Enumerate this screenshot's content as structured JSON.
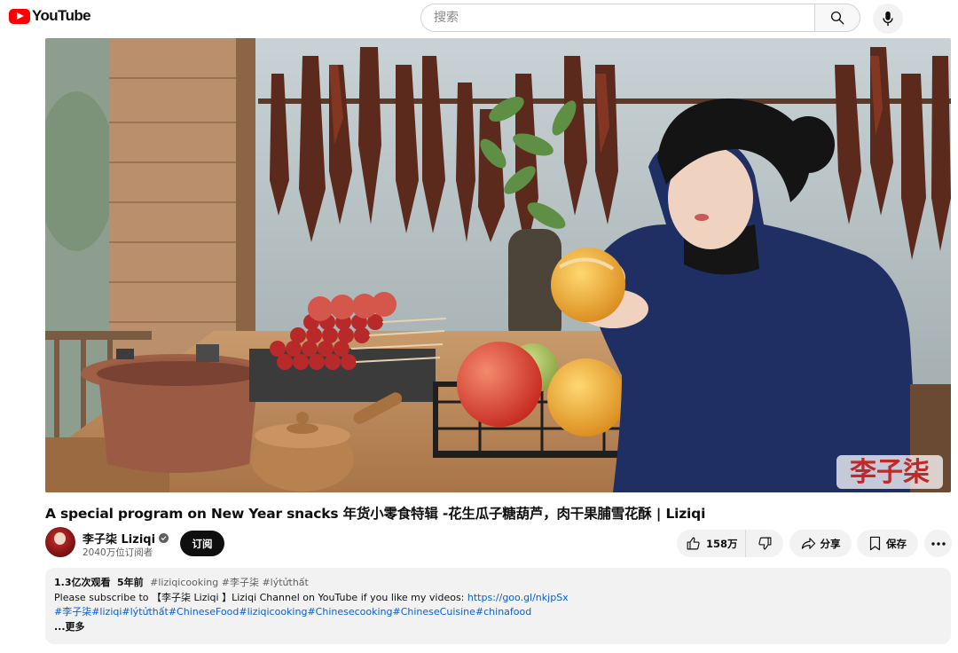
{
  "header": {
    "logo_text": "YouTube",
    "search_placeholder": "搜索",
    "icons": [
      "youtube-logo-icon",
      "search-icon",
      "mic-icon"
    ]
  },
  "video": {
    "watermark": "李子柒",
    "title": "A special program on New Year snacks 年货小零食特辑 -花生瓜子糖葫芦，肉干果脯雪花酥 | Liziqi"
  },
  "channel": {
    "name": "李子柒 Liziqi",
    "subscribers": "2040万位订阅者",
    "subscribe_label": "订阅"
  },
  "actions": {
    "like_count": "158万",
    "share_label": "分享",
    "save_label": "保存",
    "icons": [
      "like-icon",
      "dislike-icon",
      "share-icon",
      "save-icon",
      "more-icon"
    ]
  },
  "description": {
    "views": "1.3亿次观看",
    "age": "5年前",
    "inline_tags": "#liziqicooking #李子柒 #lýtửthất",
    "line1_text": "Please subscribe to 【李子柒 Liziqi 】Liziqi Channel on YouTube if you like my videos: ",
    "line1_link": "https://goo.gl/nkjpSx",
    "tags_line": "#李子柒#liziqi#lýtửthất#ChineseFood#liziqicooking#Chinesecooking#ChineseCuisine#chinafood",
    "more_label": "...更多"
  },
  "colors": {
    "brand_red": "#ff0000",
    "link_blue": "#065fd4",
    "text_primary": "#0f0f0f",
    "text_secondary": "#606060",
    "chip_bg": "#f2f2f2"
  }
}
